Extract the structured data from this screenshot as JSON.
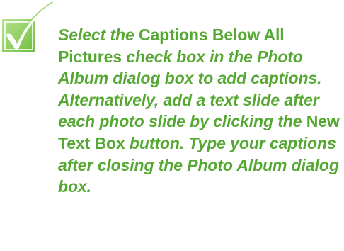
{
  "tip": {
    "icon": "checkmark-tip-icon",
    "color": "#55a832",
    "segments": [
      {
        "text": "Select the ",
        "style": "italic"
      },
      {
        "text": "Captions Below All Pictures",
        "style": "roman"
      },
      {
        "text": " check box in the Photo Album dialog box to add captions. Alternatively, add a text slide after each photo slide by clicking the ",
        "style": "italic"
      },
      {
        "text": "New Text Box",
        "style": "roman"
      },
      {
        "text": " button. Type your captions after closing the Photo Album dialog box.",
        "style": "italic"
      }
    ]
  }
}
